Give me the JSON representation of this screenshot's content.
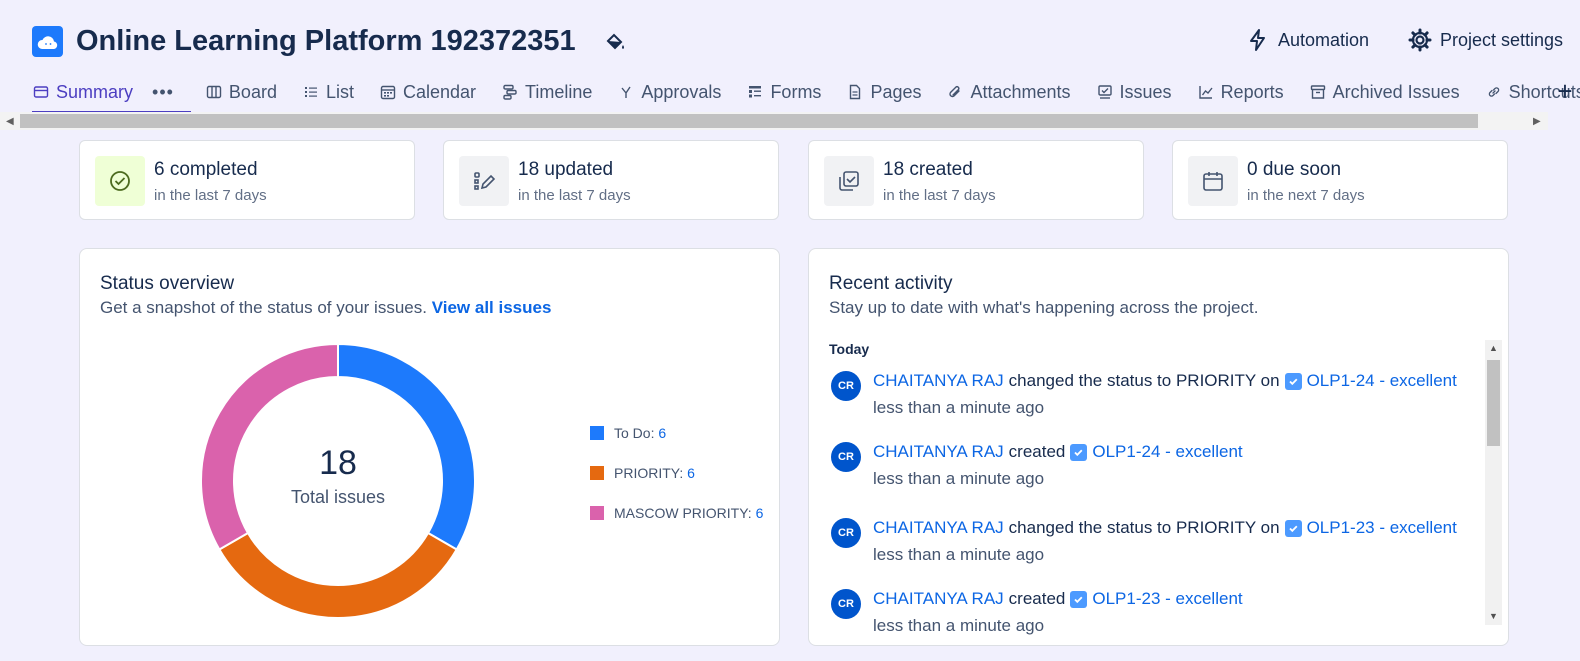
{
  "header": {
    "project_title": "Online Learning Platform 192372351",
    "automation_label": "Automation",
    "settings_label": "Project settings"
  },
  "tabs": [
    {
      "label": "Summary",
      "icon": "summary-icon",
      "active": true
    },
    {
      "label": "Board",
      "icon": "board-icon"
    },
    {
      "label": "List",
      "icon": "list-icon"
    },
    {
      "label": "Calendar",
      "icon": "calendar-icon"
    },
    {
      "label": "Timeline",
      "icon": "timeline-icon"
    },
    {
      "label": "Approvals",
      "icon": "approvals-icon"
    },
    {
      "label": "Forms",
      "icon": "forms-icon"
    },
    {
      "label": "Pages",
      "icon": "pages-icon"
    },
    {
      "label": "Attachments",
      "icon": "attachment-icon"
    },
    {
      "label": "Issues",
      "icon": "issues-icon"
    },
    {
      "label": "Reports",
      "icon": "reports-icon"
    },
    {
      "label": "Archived Issues",
      "icon": "archive-icon"
    },
    {
      "label": "Shortcuts",
      "icon": "link-icon"
    }
  ],
  "stats": [
    {
      "value": "6 completed",
      "caption": "in the last 7 days",
      "icon": "check-circle-icon"
    },
    {
      "value": "18 updated",
      "caption": "in the last 7 days",
      "icon": "edit-icon"
    },
    {
      "value": "18 created",
      "caption": "in the last 7 days",
      "icon": "created-icon"
    },
    {
      "value": "0 due soon",
      "caption": "in the next 7 days",
      "icon": "calendar-icon"
    }
  ],
  "status_overview": {
    "title": "Status overview",
    "description": "Get a snapshot of the status of your issues.",
    "link": "View all issues",
    "total": "18",
    "total_label": "Total issues"
  },
  "chart_data": {
    "type": "pie",
    "title": "",
    "categories": [
      "To Do",
      "PRIORITY",
      "MASCOW PRIORITY"
    ],
    "values": [
      6,
      6,
      6
    ],
    "colors": [
      "#1d7afc",
      "#e56910",
      "#da62ac"
    ],
    "legend_labels": [
      "To Do: ",
      "PRIORITY: ",
      "MASCOW PRIORITY: "
    ],
    "legend_counts": [
      "6",
      "6",
      "6"
    ],
    "legend_position": "right"
  },
  "recent_activity": {
    "title": "Recent activity",
    "description": "Stay up to date with what's happening across the project.",
    "group_label": "Today",
    "items": [
      {
        "initials": "CR",
        "user": "CHAITANYA RAJ",
        "action": "changed the status to PRIORITY on",
        "issue": "OLP1-24 - excellent",
        "time": "less than a minute ago"
      },
      {
        "initials": "CR",
        "user": "CHAITANYA RAJ",
        "action": "created",
        "issue": "OLP1-24 - excellent",
        "time": "less than a minute ago"
      },
      {
        "initials": "CR",
        "user": "CHAITANYA RAJ",
        "action": "changed the status to PRIORITY on",
        "issue": "OLP1-23 - excellent",
        "time": "less than a minute ago"
      },
      {
        "initials": "CR",
        "user": "CHAITANYA RAJ",
        "action": "created",
        "issue": "OLP1-23 - excellent",
        "time": "less than a minute ago"
      }
    ]
  },
  "colors": {
    "accent": "#4c3ec1",
    "link": "#0c66e4",
    "background": "#f1f0fd"
  }
}
